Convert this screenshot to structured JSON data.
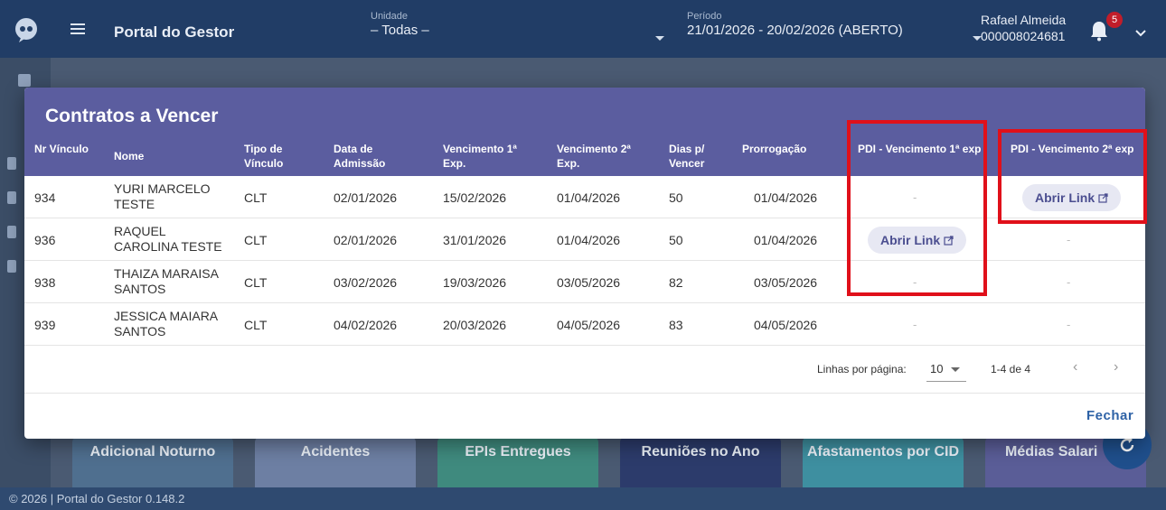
{
  "appbar": {
    "title": "Portal do Gestor",
    "unit_label": "Unidade",
    "unit_value": "– Todas –",
    "period_label": "Período",
    "period_value": "21/01/2026 - 20/02/2026 (ABERTO)",
    "user_name": "Rafael Almeida",
    "user_id": "000008024681",
    "notification_count": "5"
  },
  "background_tiles": [
    {
      "label": "Adicional Noturno",
      "color": "#4f6f8f"
    },
    {
      "label": "Acidentes",
      "color": "#6d7fa3"
    },
    {
      "label": "EPIs Entregues",
      "color": "#3f8a7e"
    },
    {
      "label": "Reuniões no Ano",
      "color": "#2c3b6b"
    },
    {
      "label": "Afastamentos por CID",
      "color": "#3e8fa0"
    },
    {
      "label": "Médias Salari",
      "color": "#5a5d97"
    }
  ],
  "footer": "© 2026 | Portal do Gestor 0.148.2",
  "modal": {
    "title": "Contratos a Vencer",
    "columns": [
      "Nr Vínculo",
      "Nome",
      "Tipo de Vínculo",
      "Data de Admissão",
      "Vencimento 1ª Exp.",
      "Vencimento 2ª Exp.",
      "Dias p/ Vencer",
      "Prorrogação",
      "PDI - Vencimento 1ª exp",
      "PDI - Vencimento 2ª exp"
    ],
    "col_headers": {
      "c0": "Nr Vínculo",
      "c1": "Nome",
      "c2a": "Tipo de",
      "c2b": "Vínculo",
      "c3a": "Data de",
      "c3b": "Admissão",
      "c4a": "Vencimento 1ª",
      "c4b": "Exp.",
      "c5a": "Vencimento 2ª",
      "c5b": "Exp.",
      "c6a": "Dias p/",
      "c6b": "Vencer",
      "c7": "Prorrogação",
      "c8": "PDI - Vencimento 1ª exp",
      "c9": "PDI - Vencimento 2ª exp"
    },
    "rows": [
      {
        "nr": "934",
        "nome1": "YURI MARCELO",
        "nome2": "TESTE",
        "tipo": "CLT",
        "admissao": "02/01/2026",
        "venc1": "15/02/2026",
        "venc2": "01/04/2026",
        "dias": "50",
        "prorrogacao": "01/04/2026",
        "pdi1": "-",
        "pdi2": "Abrir Link"
      },
      {
        "nr": "936",
        "nome1": "RAQUEL",
        "nome2": "CAROLINA TESTE",
        "tipo": "CLT",
        "admissao": "02/01/2026",
        "venc1": "31/01/2026",
        "venc2": "01/04/2026",
        "dias": "50",
        "prorrogacao": "01/04/2026",
        "pdi1": "Abrir Link",
        "pdi2": "-"
      },
      {
        "nr": "938",
        "nome1": "THAIZA MARAISA",
        "nome2": "SANTOS",
        "tipo": "CLT",
        "admissao": "03/02/2026",
        "venc1": "19/03/2026",
        "venc2": "03/05/2026",
        "dias": "82",
        "prorrogacao": "03/05/2026",
        "pdi1": "-",
        "pdi2": "-"
      },
      {
        "nr": "939",
        "nome1": "JESSICA MAIARA",
        "nome2": "SANTOS",
        "tipo": "CLT",
        "admissao": "04/02/2026",
        "venc1": "20/03/2026",
        "venc2": "04/05/2026",
        "dias": "83",
        "prorrogacao": "04/05/2026",
        "pdi1": "-",
        "pdi2": "-"
      }
    ],
    "pagination": {
      "rows_per_page_label": "Linhas por página:",
      "rows_per_page_value": "10",
      "range": "1-4 de 4",
      "prev": "‹",
      "next": "›"
    },
    "close_label": "Fechar"
  },
  "colors": {
    "appbar": "#213d66",
    "modal_header": "#5b5d9f",
    "highlight": "#e0101a",
    "link_button_bg": "#e7e8f3",
    "close_text": "#2e62a6"
  }
}
